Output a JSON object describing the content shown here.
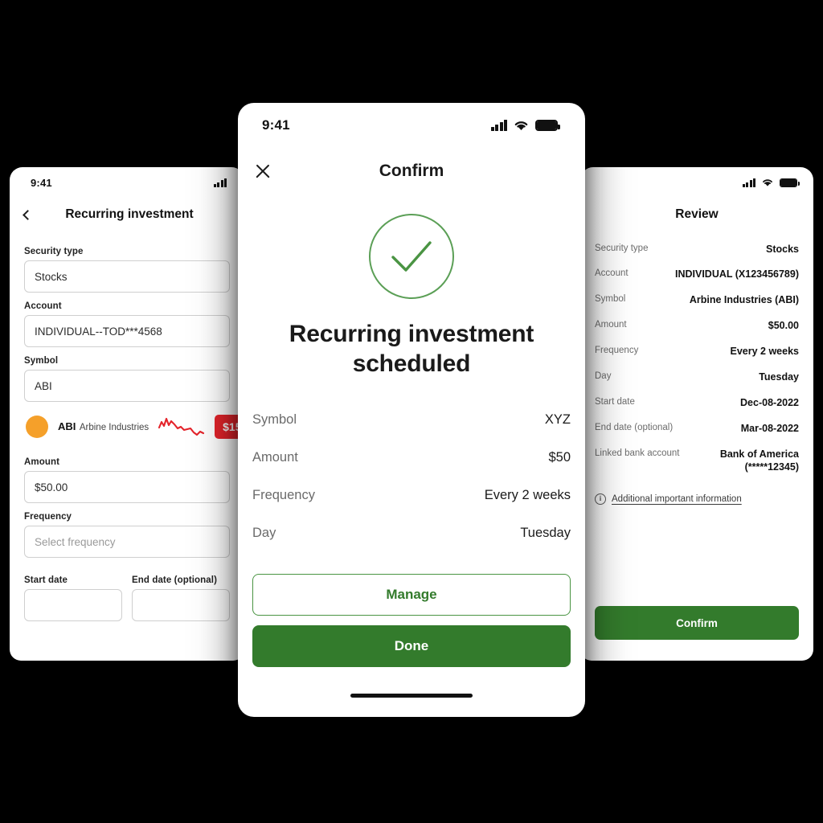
{
  "status_bar": {
    "time": "9:41",
    "icons": [
      "cellular-signal-icon",
      "wifi-icon",
      "battery-icon"
    ]
  },
  "screens": {
    "left": {
      "nav": {
        "back_icon": "chevron-left-icon",
        "title": "Recurring investment"
      },
      "fields": [
        {
          "label": "Security type",
          "value": "Stocks",
          "placeholder": "",
          "is_placeholder": false
        },
        {
          "label": "Account",
          "value": "INDIVIDUAL--TOD***4568",
          "placeholder": "",
          "is_placeholder": false
        },
        {
          "label": "Symbol",
          "value": "ABI",
          "placeholder": "",
          "is_placeholder": false
        }
      ],
      "quote": {
        "symbol": "ABI",
        "company": "Arbine Industries",
        "sparkline": "downward-trend-sparkline",
        "price_badge": "$15",
        "dot_color": "#f5a02a",
        "badge_color": "#e4242b",
        "sparkline_color": "#e4242b"
      },
      "fields2": [
        {
          "label": "Amount",
          "value": "$50.00",
          "placeholder": "",
          "is_placeholder": false
        },
        {
          "label": "Frequency",
          "value": "Select frequency",
          "placeholder": "Select frequency",
          "is_placeholder": true
        }
      ],
      "date_fields": [
        {
          "label": "Start date",
          "value": ""
        },
        {
          "label": "End date (optional)",
          "value": ""
        }
      ]
    },
    "center": {
      "nav": {
        "close_icon": "close-icon",
        "title": "Confirm"
      },
      "success_icon": "check-circle-icon",
      "heading": "Recurring investment scheduled",
      "rows": [
        {
          "label": "Symbol",
          "value": "XYZ"
        },
        {
          "label": "Amount",
          "value": "$50"
        },
        {
          "label": "Frequency",
          "value": "Every 2 weeks"
        },
        {
          "label": "Day",
          "value": "Tuesday"
        }
      ],
      "buttons": {
        "manage_label": "Manage",
        "done_label": "Done"
      },
      "home_indicator": "home-indicator"
    },
    "right": {
      "nav": {
        "title": "Review"
      },
      "rows": [
        {
          "label": "Security type",
          "value": "Stocks"
        },
        {
          "label": "Account",
          "value": "INDIVIDUAL (X123456789)"
        },
        {
          "label": "Symbol",
          "value": "Arbine Industries (ABI)"
        },
        {
          "label": "Amount",
          "value": "$50.00"
        },
        {
          "label": "Frequency",
          "value": "Every 2 weeks"
        },
        {
          "label": "Day",
          "value": "Tuesday"
        },
        {
          "label": "Start date",
          "value": "Dec-08-2022"
        },
        {
          "label": "End date (optional)",
          "value": "Mar-08-2022"
        },
        {
          "label": "Linked bank account",
          "value": "Bank of America (*****12345)"
        }
      ],
      "info_link": {
        "icon": "info-icon",
        "label": "Additional important information"
      },
      "confirm_label": "Confirm"
    }
  },
  "colors": {
    "brand_green": "#337b2c",
    "outline_green": "#4a9443",
    "check_green": "#5b9f56",
    "alert_red": "#e4242b",
    "accent_orange": "#f5a02a",
    "page_background": "#000000"
  }
}
